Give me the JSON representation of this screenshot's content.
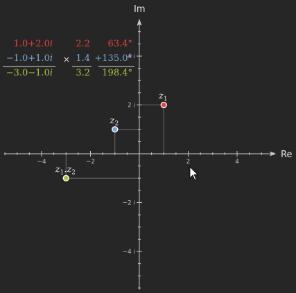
{
  "colors": {
    "z1": "#e8413a",
    "z2": "#7fa6d6",
    "product": "#b4c23d",
    "operator": "#d8d8d8"
  },
  "axes": {
    "x_label": "Re",
    "y_label": "Im",
    "x_range": [
      -5.5,
      5.5
    ],
    "y_range": [
      -5.6,
      5.4
    ],
    "x_ticks": [
      {
        "value": -4,
        "label": "−4"
      },
      {
        "value": -2,
        "label": "−2"
      },
      {
        "value": 2,
        "label": "2"
      },
      {
        "value": 4,
        "label": "4"
      }
    ],
    "y_ticks": [
      {
        "value": 4,
        "label": "4 𝑖"
      },
      {
        "value": 2,
        "label": "2 𝑖"
      },
      {
        "value": -2,
        "label": "−2 𝑖"
      },
      {
        "value": -4,
        "label": "−4 𝑖"
      }
    ]
  },
  "points": [
    {
      "id": "z1",
      "re": 1.0,
      "im": 2.0,
      "label_main": "z",
      "label_sub": "1",
      "label_pos": "above"
    },
    {
      "id": "z2",
      "re": -1.0,
      "im": 1.0,
      "label_main": "z",
      "label_sub": "2",
      "label_pos": "above"
    },
    {
      "id": "product",
      "re": -3.0,
      "im": -1.0,
      "label_main": "z",
      "label_sub": "1",
      "label_mid": ".z",
      "label_sub2": "2",
      "label_pos": "above"
    }
  ],
  "table": {
    "rows": [
      {
        "id": "z1",
        "complex": "1.0+2.0𝑖",
        "modulus": "2.2",
        "angle": "63.4°"
      },
      {
        "id": "z2",
        "complex": "−1.0+1.0𝑖",
        "modulus": "1.4",
        "angle": "+135.0°"
      },
      {
        "id": "product",
        "complex": "−3.0−1.0𝑖",
        "modulus": "3.2",
        "angle": "198.4°"
      }
    ],
    "operator": "×"
  }
}
